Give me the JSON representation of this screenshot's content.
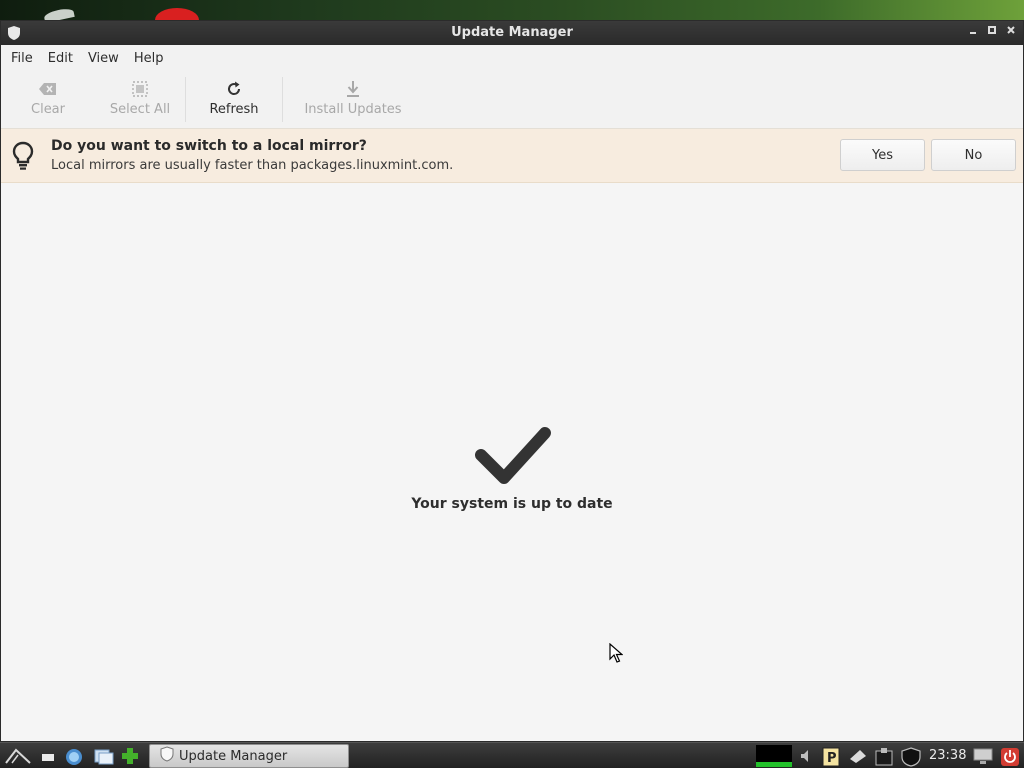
{
  "window": {
    "title": "Update Manager"
  },
  "menubar": {
    "items": [
      "File",
      "Edit",
      "View",
      "Help"
    ]
  },
  "toolbar": {
    "clear_label": "Clear",
    "select_all_label": "Select All",
    "refresh_label": "Refresh",
    "install_label": "Install Updates"
  },
  "infobar": {
    "title": "Do you want to switch to a local mirror?",
    "message": "Local mirrors are usually faster than packages.linuxmint.com.",
    "yes_label": "Yes",
    "no_label": "No"
  },
  "main": {
    "status": "Your system is up to date"
  },
  "taskbar": {
    "task_label": "Update Manager",
    "clock": "23:38"
  },
  "colors": {
    "infobar_bg": "#f7ecdf",
    "titlebar_bg": "#2f2f2f",
    "checkmark": "#333333",
    "power_button": "#d23c32"
  }
}
